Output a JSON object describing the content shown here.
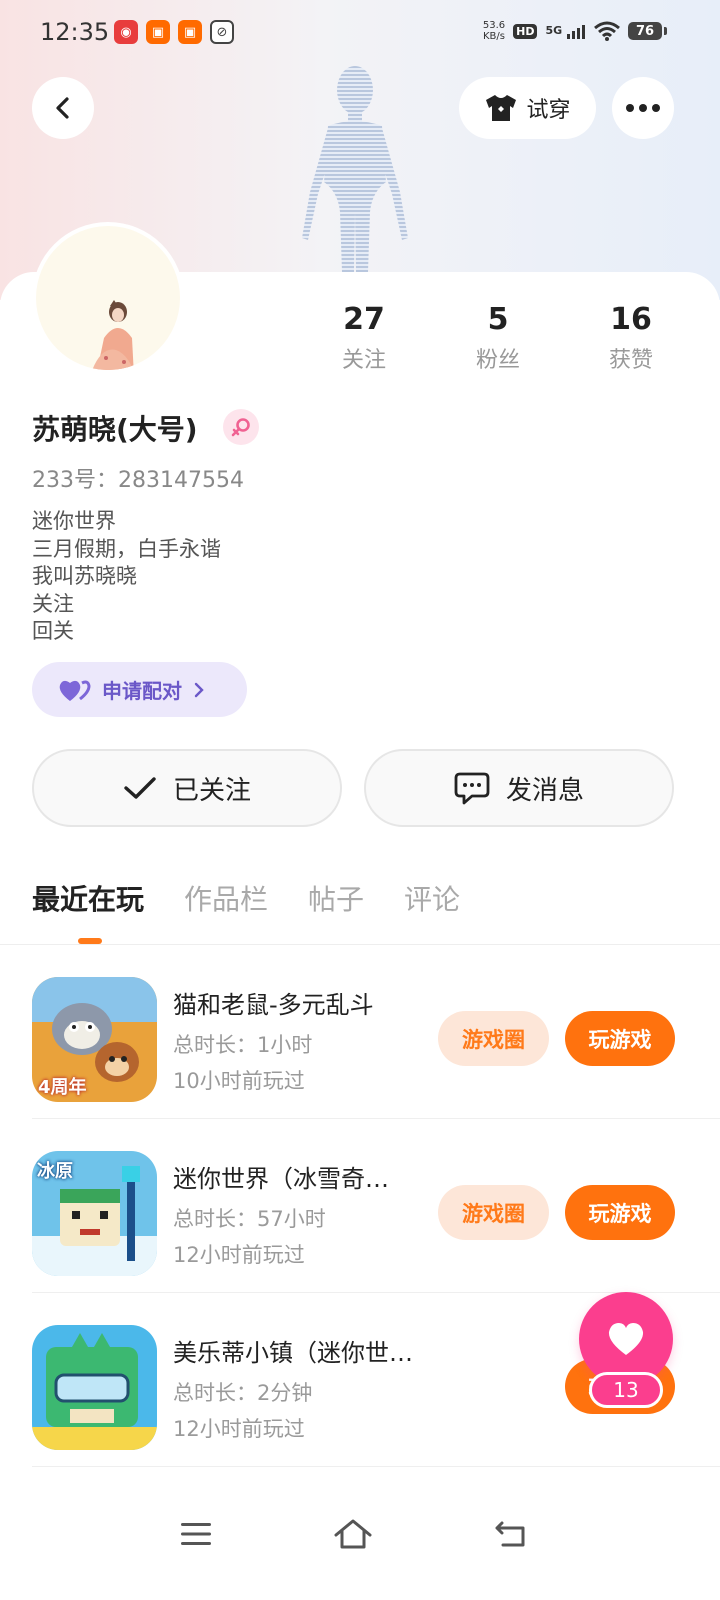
{
  "status_bar": {
    "time": "12:35",
    "speed": "53.6",
    "speed_unit": "KB/s",
    "hd": "HD",
    "network": "5G",
    "battery": "76"
  },
  "header": {
    "tryon_label": "试穿"
  },
  "profile": {
    "stats": [
      {
        "value": "27",
        "label": "关注"
      },
      {
        "value": "5",
        "label": "粉丝"
      },
      {
        "value": "16",
        "label": "获赞"
      }
    ],
    "username": "苏萌晓(大号)",
    "user_id": "233号：283147554",
    "bio": [
      "迷你世界",
      "三月假期，白手永谐",
      "我叫苏晓晓",
      "关注",
      "回关"
    ],
    "pair_label": "申请配对"
  },
  "actions": {
    "follow_label": "已关注",
    "message_label": "发消息"
  },
  "tabs": [
    {
      "label": "最近在玩",
      "active": true
    },
    {
      "label": "作品栏",
      "active": false
    },
    {
      "label": "帖子",
      "active": false
    },
    {
      "label": "评论",
      "active": false
    }
  ],
  "games": [
    {
      "name": "猫和老鼠-多元乱斗",
      "duration": "总时长：1小时",
      "last_played": "10小时前玩过",
      "circle_label": "游戏圈",
      "play_label": "玩游戏"
    },
    {
      "name": "迷你世界（冰雪奇…",
      "duration": "总时长：57小时",
      "last_played": "12小时前玩过",
      "circle_label": "游戏圈",
      "play_label": "玩游戏"
    },
    {
      "name": "美乐蒂小镇（迷你世界）",
      "duration": "总时长：2分钟",
      "last_played": "12小时前玩过",
      "circle_label": "",
      "play_label": "玩游戏"
    }
  ],
  "game_icon_text": {
    "tom_jerry": "4周年",
    "mini_world": "冰原"
  },
  "like": {
    "count": "13"
  },
  "colors": {
    "accent": "#ff720e",
    "like": "#fb3e8e",
    "pair": "#6b58c8"
  }
}
